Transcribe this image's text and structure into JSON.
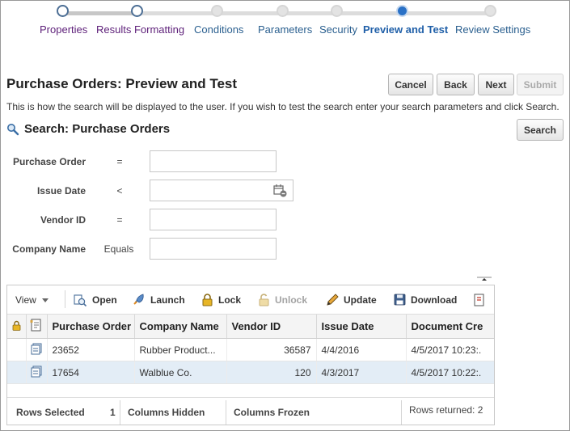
{
  "train": {
    "steps": [
      {
        "label": "Properties",
        "state": "visited"
      },
      {
        "label": "Results Formatting",
        "state": "visited"
      },
      {
        "label": "Conditions",
        "state": "future"
      },
      {
        "label": "Parameters",
        "state": "future"
      },
      {
        "label": "Security",
        "state": "future"
      },
      {
        "label": "Preview and Test",
        "state": "current"
      },
      {
        "label": "Review Settings",
        "state": "future"
      }
    ]
  },
  "header": {
    "title": "Purchase Orders: Preview and Test",
    "cancel_label": "Cancel",
    "back_label": "Back",
    "next_label": "Next",
    "submit_label": "Submit",
    "instructions": "This is how the search will be displayed to the user. If you wish to test the search enter your search parameters and click Search."
  },
  "search": {
    "heading": "Search: Purchase Orders",
    "button_label": "Search",
    "fields": [
      {
        "label": "Purchase Order",
        "operator": "=",
        "value": ""
      },
      {
        "label": "Issue Date",
        "operator": "<",
        "value": ""
      },
      {
        "label": "Vendor ID",
        "operator": "=",
        "value": ""
      },
      {
        "label": "Company Name",
        "operator": "Equals",
        "value": ""
      }
    ]
  },
  "toolbar": {
    "view_label": "View",
    "open_label": "Open",
    "launch_label": "Launch",
    "lock_label": "Lock",
    "unlock_label": "Unlock",
    "update_label": "Update",
    "download_label": "Download"
  },
  "table": {
    "columns": [
      "Purchase Order",
      "Company Name",
      "Vendor ID",
      "Issue Date",
      "Document Cre"
    ],
    "rows": [
      {
        "purchase_order": "23652",
        "company_name": "Rubber Product...",
        "vendor_id": "36587",
        "issue_date": "4/4/2016",
        "document_created": "4/5/2017 10:23:.",
        "selected": false
      },
      {
        "purchase_order": "17654",
        "company_name": "Walblue Co.",
        "vendor_id": "120",
        "issue_date": "4/3/2017",
        "document_created": "4/5/2017 10:22:.",
        "selected": true
      }
    ]
  },
  "footer": {
    "rows_selected_label": "Rows Selected",
    "rows_selected_value": "1",
    "columns_hidden_label": "Columns Hidden",
    "columns_frozen_label": "Columns Frozen",
    "rows_returned": "Rows returned: 2"
  },
  "colors": {
    "accent": "#2a71c6",
    "visited_link": "#5d1f79",
    "link": "#2a5f8f",
    "selected_row": "#e3edf6"
  }
}
